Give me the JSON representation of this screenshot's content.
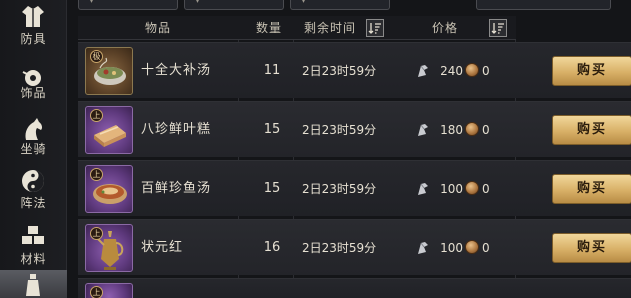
{
  "sidebar": {
    "items": [
      {
        "label": "防具",
        "icon": "robe-icon"
      },
      {
        "label": "饰品",
        "icon": "pendant-icon"
      },
      {
        "label": "坐骑",
        "icon": "horse-icon"
      },
      {
        "label": "阵法",
        "icon": "taiji-icon"
      },
      {
        "label": "材料",
        "icon": "blocks-icon"
      },
      {
        "label": "",
        "icon": "bottle-icon"
      }
    ]
  },
  "table": {
    "headers": {
      "item": "物品",
      "qty": "数量",
      "time": "剩余时间",
      "price": "价格"
    },
    "rows": [
      {
        "badge": "极",
        "name": "十全大补汤",
        "qty": "11",
        "time": "2日23时59分",
        "silver": "240",
        "copper": "0",
        "buy": "购买",
        "icon": "soup-bowl-icon"
      },
      {
        "badge": "上",
        "name": "八珍鲜叶糕",
        "qty": "15",
        "time": "2日23时59分",
        "silver": "180",
        "copper": "0",
        "buy": "购买",
        "icon": "cake-icon"
      },
      {
        "badge": "上",
        "name": "百鲜珍鱼汤",
        "qty": "15",
        "time": "2日23时59分",
        "silver": "100",
        "copper": "0",
        "buy": "购买",
        "icon": "fish-soup-icon"
      },
      {
        "badge": "上",
        "name": "状元红",
        "qty": "16",
        "time": "2日23时59分",
        "silver": "100",
        "copper": "0",
        "buy": "购买",
        "icon": "wine-jug-icon"
      },
      {
        "badge": "上",
        "name": "",
        "qty": "",
        "time": "",
        "silver": "",
        "copper": "",
        "buy": "",
        "icon": "item-icon"
      }
    ]
  },
  "colors": {
    "accent_gold": "#d8b067",
    "rank_gold_frame": "#8c7950",
    "rank_purple_bg": "#5f3a7e"
  }
}
